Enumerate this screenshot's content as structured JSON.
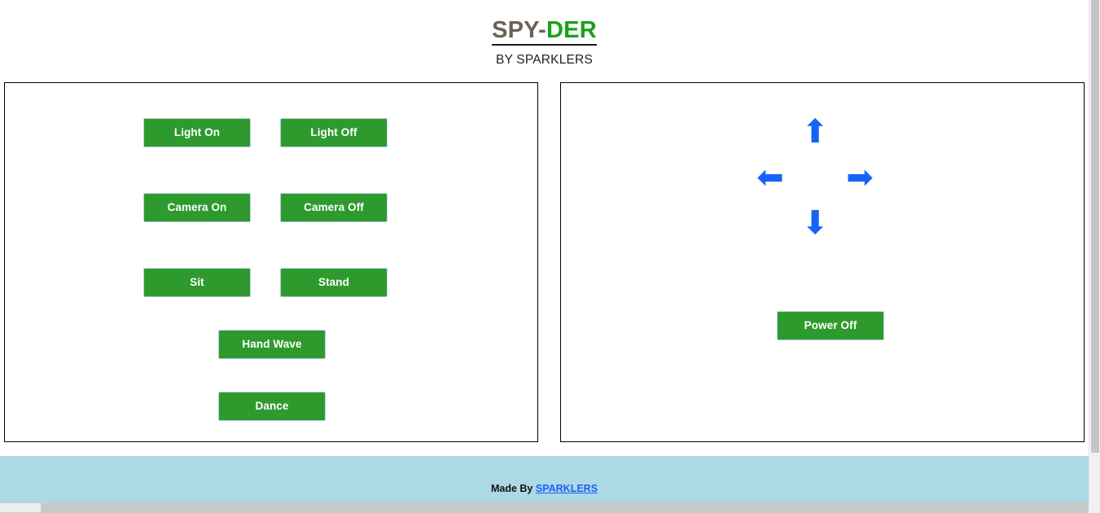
{
  "header": {
    "title_part_a": "SPY-",
    "title_part_b": "DER",
    "subtitle": "BY SPARKLERS",
    "title_color_a": "#6b6257",
    "title_color_b": "#1aa01a"
  },
  "theme": {
    "button_green": "#2e9a2e",
    "arrow_blue": "#1763f5",
    "footer_blue": "#add8e6",
    "link_blue": "#1763f5",
    "panel_border": "#000000"
  },
  "controls_panel": {
    "buttons": [
      {
        "label": "Light On",
        "icon": "light-on-icon"
      },
      {
        "label": "Light Off",
        "icon": "light-off-icon"
      },
      {
        "label": "Camera On",
        "icon": "camera-on-icon"
      },
      {
        "label": "Camera Off",
        "icon": "camera-off-icon"
      },
      {
        "label": "Sit",
        "icon": "sit-icon"
      },
      {
        "label": "Stand",
        "icon": "stand-icon"
      },
      {
        "label": "Hand Wave",
        "icon": "hand-wave-icon"
      },
      {
        "label": "Dance",
        "icon": "dance-icon"
      }
    ]
  },
  "navigation_panel": {
    "arrows": [
      {
        "name": "arrow-up-icon",
        "glyph": "⬆"
      },
      {
        "name": "arrow-left-icon",
        "glyph": "⬅"
      },
      {
        "name": "arrow-right-icon",
        "glyph": "➡"
      },
      {
        "name": "arrow-down-icon",
        "glyph": "⬇"
      }
    ],
    "power_button": "Power Off"
  },
  "footer": {
    "made_by": "Made By ",
    "link_label": "SPARKLERS"
  }
}
